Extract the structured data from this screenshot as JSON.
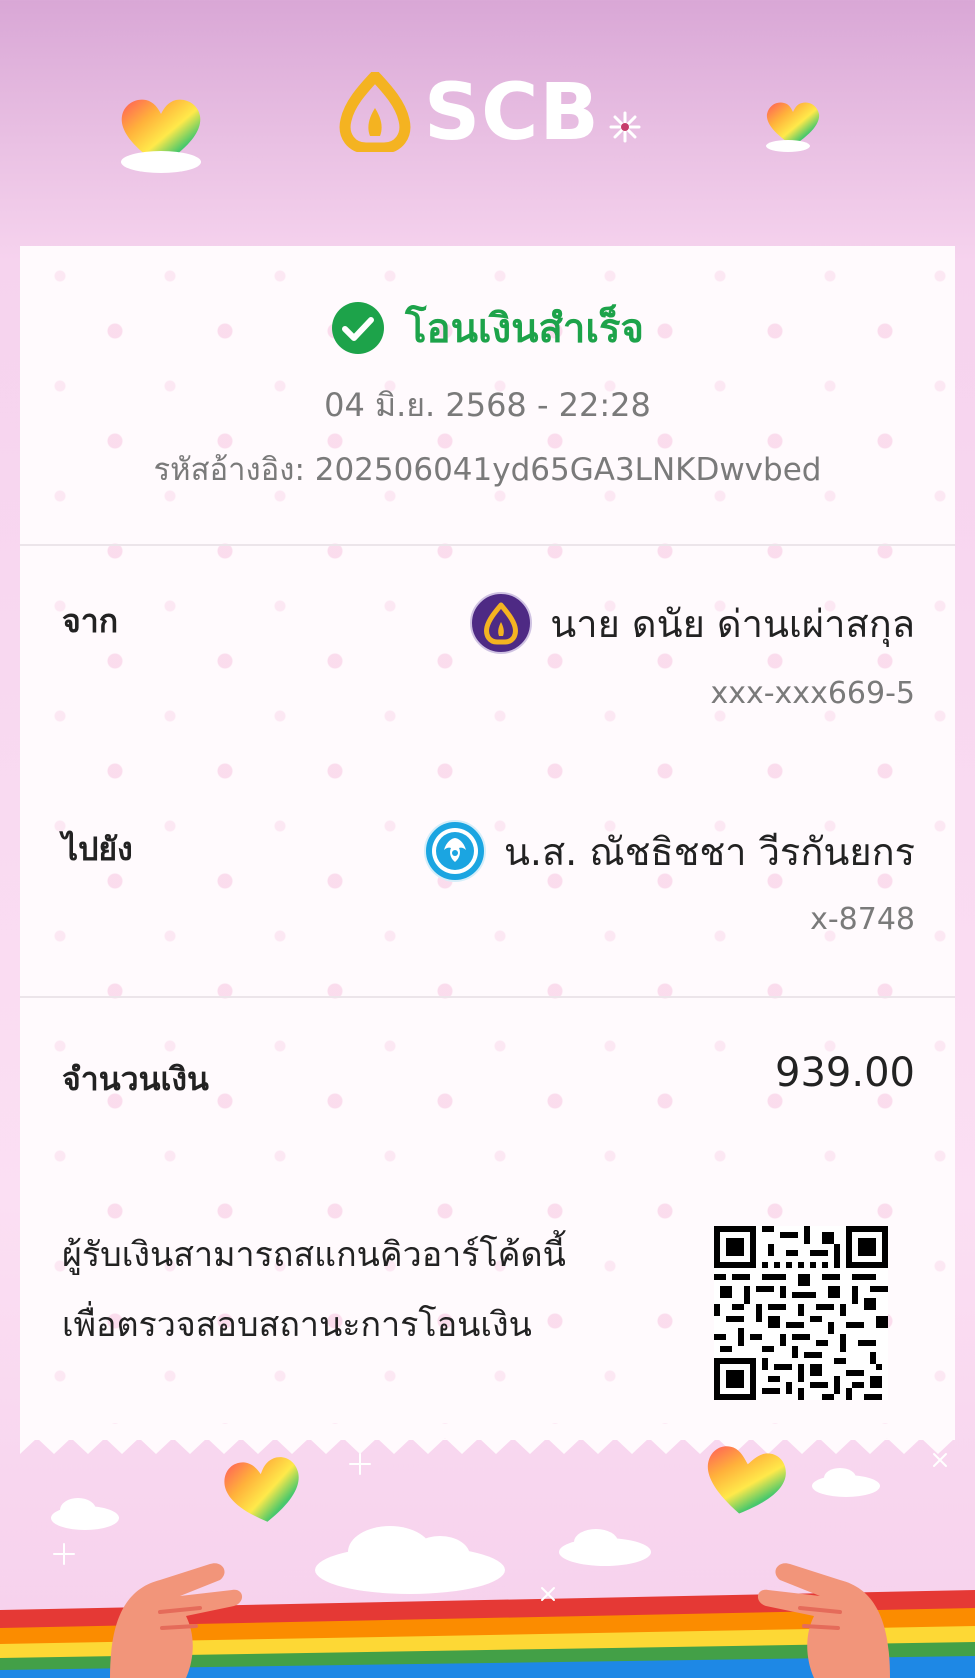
{
  "brand": {
    "name": "SCB",
    "logo_color": "#f4b321",
    "accent_color": "#4e2a84"
  },
  "header": {
    "icons": [
      "scb-logo-icon",
      "rainbow-heart-icon",
      "sparkle-icon"
    ]
  },
  "receipt": {
    "status": {
      "text": "โอนเงินสำเร็จ",
      "icon": "check-circle-icon",
      "color": "#1da34a"
    },
    "datetime": "04 มิ.ย. 2568 - 22:28",
    "reference": "รหัสอ้างอิง: 202506041yd65GA3LNKDwvbed",
    "from": {
      "label": "จาก",
      "name": "นาย ดนัย ด่านเผ่าสกุล",
      "account": "xxx-xxx669-5",
      "bank_icon": "scb-bank-icon"
    },
    "to": {
      "label": "ไปยัง",
      "name": "น.ส. ณัชธิชชา วีรกันยกร",
      "account": "x-8748",
      "bank_icon": "krungthai-bank-icon"
    },
    "amount": {
      "label": "จำนวนเงิน",
      "value": "939.00"
    },
    "qr": {
      "caption_line1": "ผู้รับเงินสามารถสแกนคิวอาร์โค้ดนี้",
      "caption_line2": "เพื่อตรวจสอบสถานะการโอนเงิน",
      "icon": "qr-code-icon"
    }
  },
  "footer": {
    "icons": [
      "rainbow-heart-icon",
      "heart-hand-icon",
      "cloud-icon",
      "rainbow-flag-icon"
    ]
  }
}
